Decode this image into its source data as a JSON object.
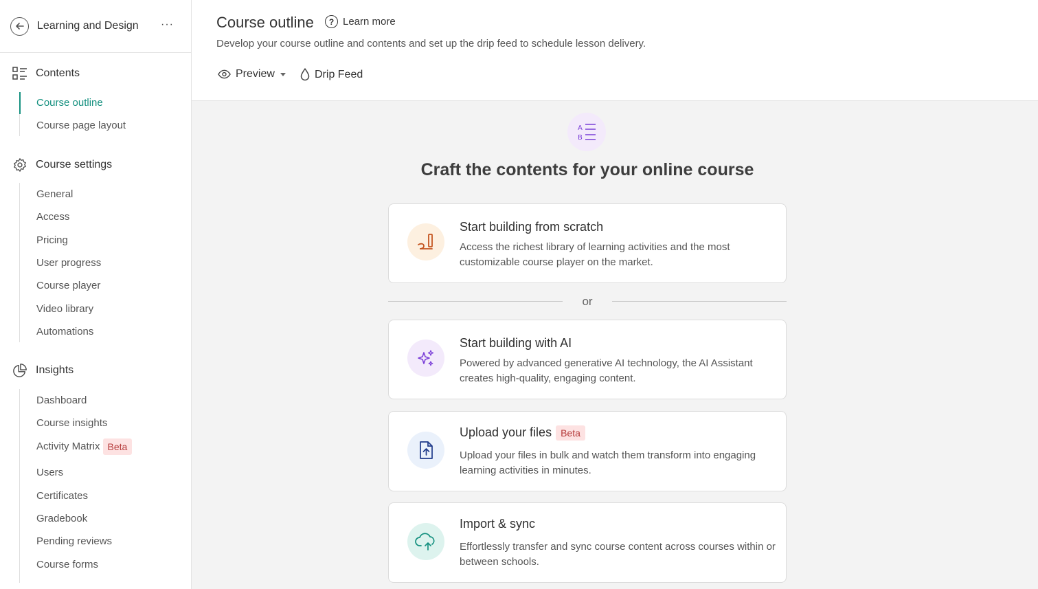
{
  "sidebar": {
    "title": "Learning and Design",
    "more": "···",
    "contents": {
      "label": "Contents",
      "items": [
        "Course outline",
        "Course page layout"
      ]
    },
    "settings": {
      "label": "Course settings",
      "items": [
        "General",
        "Access",
        "Pricing",
        "User progress",
        "Course player",
        "Video library",
        "Automations"
      ]
    },
    "insights": {
      "label": "Insights",
      "items": [
        "Dashboard",
        "Course insights",
        "Activity Matrix",
        "Users",
        "Certificates",
        "Gradebook",
        "Pending reviews",
        "Course forms"
      ],
      "beta": "Beta"
    }
  },
  "header": {
    "title": "Course outline",
    "learn_more": "Learn more",
    "description": "Develop your course outline and contents and set up the drip feed to schedule lesson delivery.",
    "preview": "Preview",
    "drip_feed": "Drip Feed"
  },
  "content": {
    "hero_title": "Craft the contents for your online course",
    "or": "or",
    "cards": [
      {
        "title": "Start building from scratch",
        "desc": "Access the richest library of learning activities and the most customizable course player on the market."
      },
      {
        "title": "Start building with AI",
        "desc": "Powered by advanced generative AI technology, the AI Assistant creates high-quality, engaging content."
      },
      {
        "title": "Upload your files",
        "badge": "Beta",
        "desc": "Upload your files in bulk and watch them transform into engaging learning activities in minutes."
      },
      {
        "title": "Import & sync",
        "desc": "Effortlessly transfer and sync course content across courses within or between schools."
      }
    ]
  },
  "colors": {
    "accent": "#14907f",
    "beta_bg": "#fde2e2",
    "beta_text": "#b53a3a",
    "ai_purple": "#7b3fd8"
  }
}
